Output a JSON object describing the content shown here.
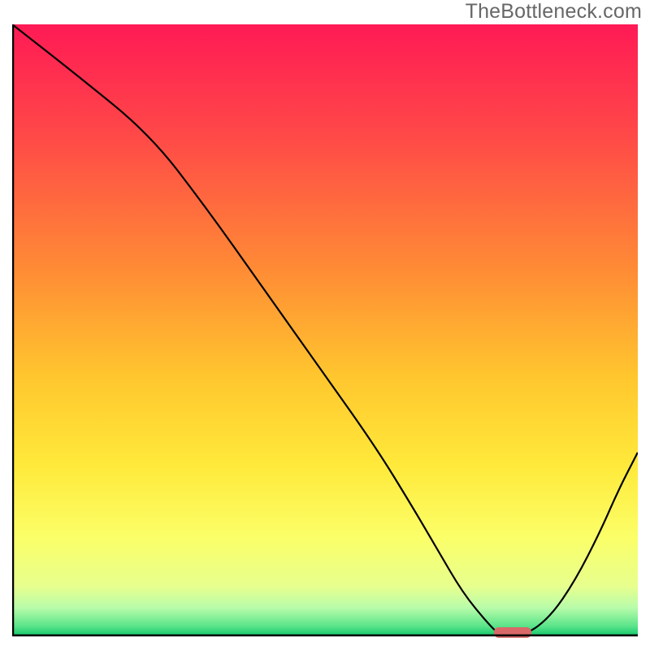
{
  "watermark": "TheBottleneck.com",
  "chart_data": {
    "type": "line",
    "title": "",
    "xlabel": "",
    "ylabel": "",
    "xlim": [
      0,
      100
    ],
    "ylim": [
      0,
      100
    ],
    "x": [
      0,
      10,
      22,
      31,
      40,
      49,
      58,
      64,
      68,
      72,
      76,
      78,
      82,
      86,
      90,
      94,
      97,
      100
    ],
    "values": [
      100,
      92,
      82,
      70,
      57,
      44,
      31,
      21,
      14,
      7,
      2,
      0,
      0,
      3,
      9,
      17,
      24,
      30
    ],
    "minimum_marker": {
      "x_start": 77,
      "x_end": 83,
      "y": 0
    },
    "gradient_stops": [
      {
        "offset": 0.0,
        "color": "#ff1a55"
      },
      {
        "offset": 0.18,
        "color": "#ff4848"
      },
      {
        "offset": 0.4,
        "color": "#ff8b35"
      },
      {
        "offset": 0.58,
        "color": "#ffc72e"
      },
      {
        "offset": 0.72,
        "color": "#ffe93a"
      },
      {
        "offset": 0.84,
        "color": "#fbff68"
      },
      {
        "offset": 0.92,
        "color": "#e7ff8e"
      },
      {
        "offset": 0.955,
        "color": "#b8fcaa"
      },
      {
        "offset": 0.985,
        "color": "#5ae48a"
      },
      {
        "offset": 1.0,
        "color": "#16c86d"
      }
    ]
  }
}
